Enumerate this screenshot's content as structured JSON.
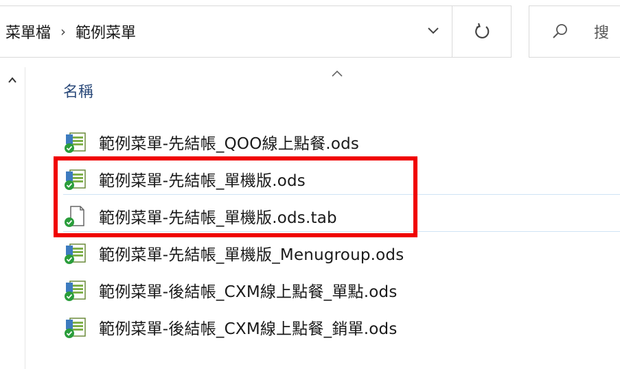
{
  "address": {
    "crumb_parent": "菜單檔",
    "separator": "›",
    "crumb_current": "範例菜單"
  },
  "search": {
    "placeholder": "搜"
  },
  "header": {
    "name_column": "名稱"
  },
  "files": [
    {
      "name": "範例菜單-先結帳_QOO線上點餐.ods",
      "icon": "ods-spreadsheet-icon"
    },
    {
      "name": "範例菜單-先結帳_單機版.ods",
      "icon": "ods-spreadsheet-icon"
    },
    {
      "name": "範例菜單-先結帳_單機版.ods.tab",
      "icon": "generic-file-icon"
    },
    {
      "name": "範例菜單-先結帳_單機版_Menugroup.ods",
      "icon": "ods-spreadsheet-icon"
    },
    {
      "name": "範例菜單-後結帳_CXM線上點餐_單點.ods",
      "icon": "ods-spreadsheet-icon"
    },
    {
      "name": "範例菜單-後結帳_CXM線上點餐_銷單.ods",
      "icon": "ods-spreadsheet-icon"
    }
  ],
  "colors": {
    "highlight": "#f00000",
    "header_text": "#2b4a7a",
    "sync_badge": "#2a9d3b"
  }
}
